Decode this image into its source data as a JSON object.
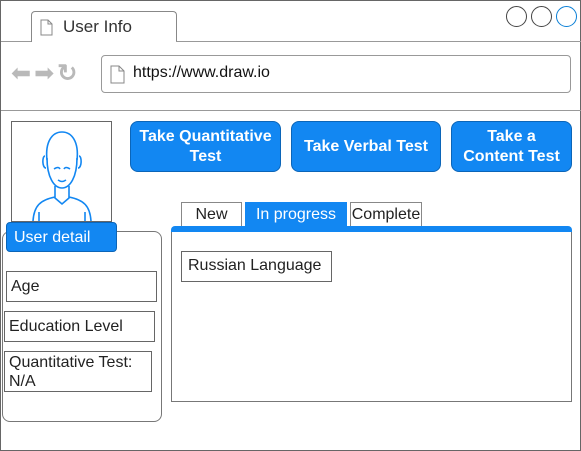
{
  "window": {
    "tab_title": "User Info",
    "url": "https://www.draw.io",
    "nav": {
      "back_icon": "⬅",
      "forward_icon": "➡",
      "refresh_icon": "↻"
    }
  },
  "actions": {
    "quantitative": "Take Quantitative Test",
    "verbal": "Take Verbal Test",
    "content": "Take a Content Test"
  },
  "user_detail": {
    "title": "User detail",
    "fields": {
      "age": "Age",
      "education": "Education Level",
      "quantitative": "Quantitative Test: N/A"
    }
  },
  "tests": {
    "tabs": {
      "new": "New",
      "in_progress": "In progress",
      "complete": "Complete"
    },
    "active_tab": "In progress",
    "items": [
      "Russian Language"
    ]
  },
  "colors": {
    "accent": "#1287f2",
    "close_button": "#0a7fd6"
  }
}
